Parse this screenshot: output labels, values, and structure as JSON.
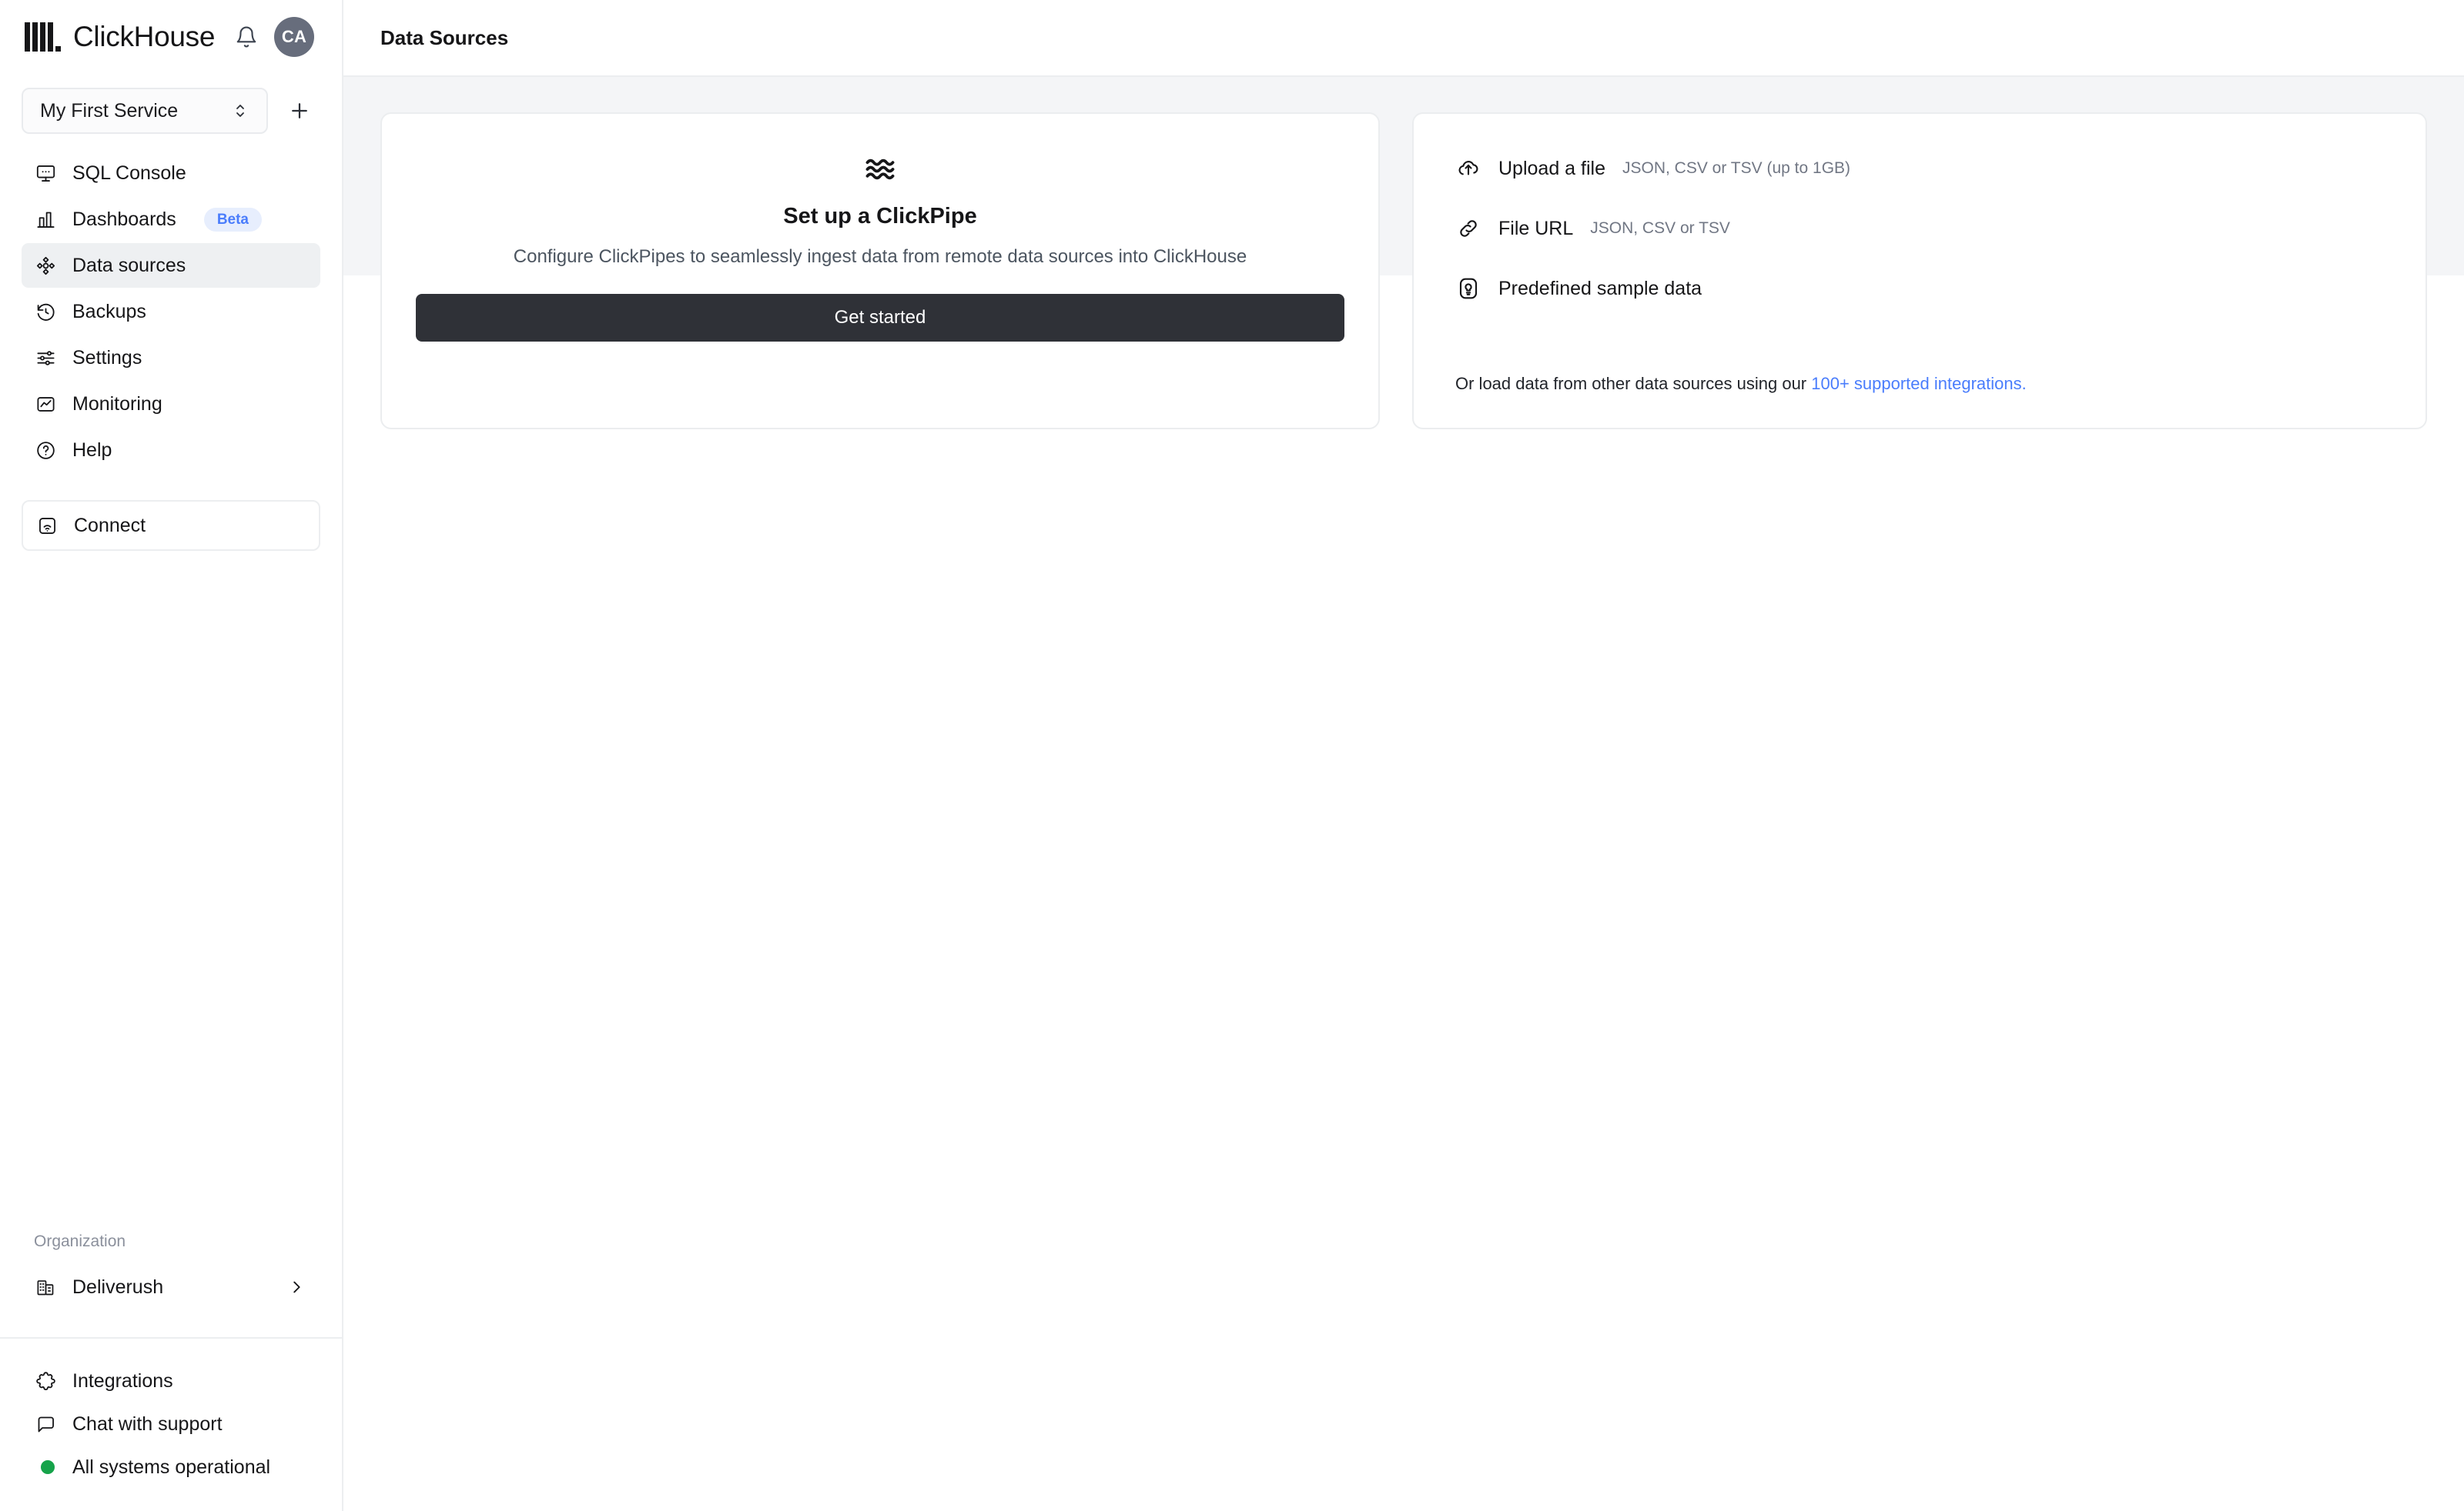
{
  "brand": {
    "name": "ClickHouse",
    "bell_icon": "bell-icon",
    "avatar_initials": "CA"
  },
  "service_selector": {
    "value": "My First Service",
    "chevron_icon": "chevron-up-down-icon",
    "add_icon": "plus-icon"
  },
  "sidebar": {
    "nav_items": [
      {
        "label": "SQL Console",
        "icon": "sql-console-icon",
        "active": false
      },
      {
        "label": "Dashboards",
        "icon": "dashboards-icon",
        "badge": "Beta",
        "active": false
      },
      {
        "label": "Data sources",
        "icon": "data-sources-icon",
        "active": true
      },
      {
        "label": "Backups",
        "icon": "backups-icon",
        "active": false
      },
      {
        "label": "Settings",
        "icon": "settings-icon",
        "active": false
      },
      {
        "label": "Monitoring",
        "icon": "monitoring-icon",
        "active": false
      },
      {
        "label": "Help",
        "icon": "help-icon",
        "active": false
      }
    ],
    "connect": {
      "label": "Connect",
      "icon": "connect-icon"
    },
    "organization": {
      "section_label": "Organization",
      "name": "Deliverush",
      "icon": "organization-icon",
      "chevron_icon": "chevron-right-icon"
    },
    "footer_items": [
      {
        "label": "Integrations",
        "icon": "integrations-icon"
      },
      {
        "label": "Chat with support",
        "icon": "chat-icon"
      },
      {
        "label": "All systems operational",
        "icon": "status-dot-icon"
      }
    ]
  },
  "header": {
    "title": "Data Sources"
  },
  "clickpipe_card": {
    "icon": "waves-icon",
    "title": "Set up a ClickPipe",
    "description": "Configure ClickPipes to seamlessly ingest data from remote data sources into ClickHouse",
    "button_label": "Get started"
  },
  "sources_card": {
    "options": [
      {
        "label": "Upload a file",
        "hint": "JSON, CSV or TSV (up to 1GB)",
        "icon": "cloud-upload-icon"
      },
      {
        "label": "File URL",
        "hint": "JSON, CSV or TSV",
        "icon": "link-icon"
      },
      {
        "label": "Predefined sample data",
        "hint": "",
        "icon": "lightbulb-icon"
      }
    ],
    "footer_text": "Or load data from other data sources using our ",
    "footer_link": "100+ supported integrations."
  },
  "colors": {
    "accent_blue": "#4a7dfc",
    "button_dark": "#2f3137",
    "status_green": "#16a34a",
    "banner_bg": "#f4f5f7",
    "avatar_bg": "#676d7c"
  }
}
